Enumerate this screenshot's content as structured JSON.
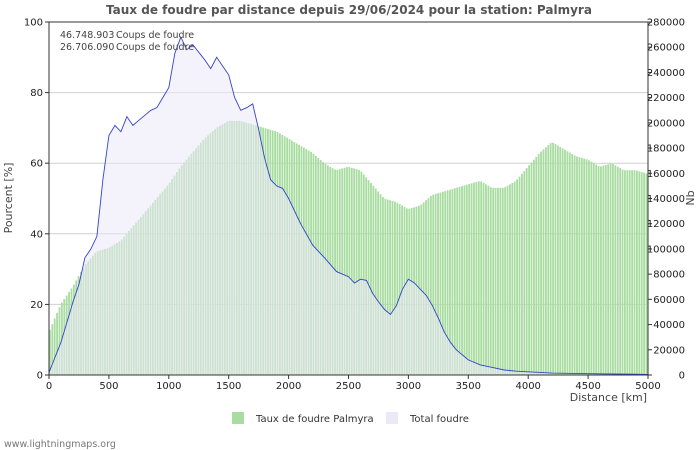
{
  "chart_data": {
    "type": "bar",
    "title": "Taux de foudre par distance depuis 29/06/2024 pour la station: Palmyra",
    "xlabel": "Distance   [km]",
    "ylabel_left": "Pourcent   [%]",
    "ylabel_right": "Nb",
    "xlim": [
      0,
      5000
    ],
    "ylim_left": [
      0,
      100
    ],
    "ylim_right": [
      0,
      280000
    ],
    "x_ticks": [
      "0",
      "500",
      "1000",
      "1500",
      "2000",
      "2500",
      "3000",
      "3500",
      "4000",
      "4500",
      "5000"
    ],
    "y_left_ticks": [
      "0",
      "20",
      "40",
      "60",
      "80",
      "100"
    ],
    "y_right_ticks": [
      "0",
      "20000",
      "40000",
      "60000",
      "80000",
      "100000",
      "120000",
      "140000",
      "160000",
      "180000",
      "200000",
      "220000",
      "240000",
      "260000",
      "280000"
    ],
    "grid": true,
    "stats": [
      {
        "value": "46.748.903",
        "label": "Coups de foudre"
      },
      {
        "value": "26.706.090",
        "label": "Coups de foudre"
      }
    ],
    "series": [
      {
        "name": "Taux de foudre Palmyra",
        "type": "bar",
        "axis": "left",
        "color": "#a8dca0",
        "x": [
          0,
          100,
          200,
          300,
          400,
          500,
          600,
          700,
          800,
          900,
          1000,
          1100,
          1200,
          1300,
          1400,
          1500,
          1600,
          1700,
          1800,
          1900,
          2000,
          2100,
          2200,
          2300,
          2400,
          2500,
          2600,
          2700,
          2800,
          2900,
          3000,
          3100,
          3200,
          3300,
          3400,
          3500,
          3600,
          3700,
          3800,
          3900,
          4000,
          4100,
          4200,
          4300,
          4400,
          4500,
          4600,
          4700,
          4800,
          4900,
          5000
        ],
        "values": [
          12,
          20,
          25,
          31,
          35,
          36,
          38,
          42,
          46,
          50,
          54,
          59,
          63,
          67,
          70,
          72,
          72,
          71,
          70,
          69,
          67,
          65,
          63,
          60,
          58,
          59,
          58,
          54,
          50,
          49,
          47,
          48,
          51,
          52,
          53,
          54,
          55,
          53,
          53,
          55,
          59,
          63,
          66,
          64,
          62,
          61,
          59,
          60,
          58,
          58,
          57
        ]
      },
      {
        "name": "Total foudre",
        "type": "area",
        "axis": "right",
        "color": "#ebe8f8",
        "line_color": "#3344cc",
        "x": [
          0,
          100,
          200,
          250,
          300,
          350,
          400,
          450,
          500,
          550,
          600,
          650,
          700,
          750,
          800,
          850,
          900,
          950,
          1000,
          1050,
          1100,
          1150,
          1200,
          1250,
          1300,
          1350,
          1400,
          1450,
          1500,
          1550,
          1600,
          1650,
          1700,
          1750,
          1800,
          1850,
          1900,
          1950,
          2000,
          2100,
          2200,
          2300,
          2400,
          2500,
          2550,
          2600,
          2650,
          2700,
          2750,
          2800,
          2850,
          2900,
          2950,
          3000,
          3050,
          3100,
          3150,
          3200,
          3250,
          3300,
          3350,
          3400,
          3500,
          3600,
          3700,
          3800,
          3900,
          4000,
          4200,
          4500,
          5000
        ],
        "values": [
          2000,
          26000,
          58000,
          72000,
          93000,
          100000,
          110000,
          155000,
          190000,
          198000,
          193000,
          205000,
          198000,
          202000,
          206000,
          210000,
          212000,
          220000,
          228000,
          255000,
          268000,
          258000,
          262000,
          256000,
          250000,
          243000,
          252000,
          245000,
          238000,
          220000,
          210000,
          212000,
          215000,
          195000,
          172000,
          155000,
          150000,
          148000,
          140000,
          120000,
          103000,
          93000,
          82000,
          78000,
          73000,
          76000,
          75000,
          65000,
          58000,
          52000,
          48000,
          55000,
          68000,
          76000,
          73000,
          68000,
          63000,
          55000,
          45000,
          34000,
          26000,
          20000,
          12000,
          8000,
          6000,
          4000,
          3000,
          2500,
          1500,
          1000,
          500
        ]
      }
    ],
    "legend_position": "bottom"
  },
  "footer": {
    "site": "www.lightningmaps.org"
  }
}
